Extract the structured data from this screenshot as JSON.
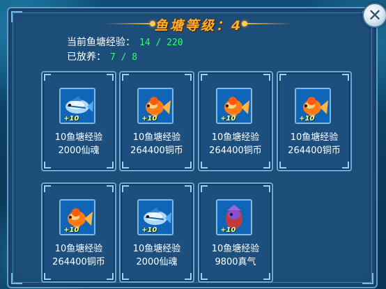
{
  "dialog": {
    "title": "鱼塘等级：4",
    "close_label": "✕",
    "pond_exp_label": "当前鱼塘经验：",
    "pond_exp_value": "14 / 220",
    "stocked_label": "已放养：",
    "stocked_value": "7 / 8"
  },
  "colors": {
    "title": "#ffb02a",
    "value_green": "#2eff6a",
    "panel_bg": "#1d4e7a"
  },
  "fish": [
    {
      "type": "blue-fish",
      "badge": "+10",
      "exp": "10鱼塘经验",
      "reward": "2000仙魂"
    },
    {
      "type": "goldfish",
      "badge": "+10",
      "exp": "10鱼塘经验",
      "reward": "264400铜币"
    },
    {
      "type": "goldfish",
      "badge": "+10",
      "exp": "10鱼塘经验",
      "reward": "264400铜币"
    },
    {
      "type": "goldfish",
      "badge": "+10",
      "exp": "10鱼塘经验",
      "reward": "264400铜币"
    },
    {
      "type": "goldfish",
      "badge": "+10",
      "exp": "10鱼塘经验",
      "reward": "264400铜币"
    },
    {
      "type": "blue-fish",
      "badge": "+10",
      "exp": "10鱼塘经验",
      "reward": "2000仙魂"
    },
    {
      "type": "purple-fish",
      "badge": "+10",
      "exp": "10鱼塘经验",
      "reward": "9800真气"
    }
  ]
}
